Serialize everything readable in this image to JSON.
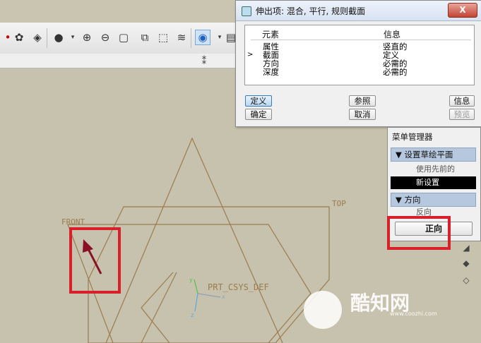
{
  "dialog": {
    "title": "伸出项: 混合, 平行, 规则截面",
    "close_label": "X",
    "columns": [
      "元素",
      "信息"
    ],
    "rows": [
      {
        "element": "属性",
        "info": "竖直的",
        "current": false
      },
      {
        "element": "截面",
        "info": "定义",
        "current": true
      },
      {
        "element": "方向",
        "info": "必需的",
        "current": false
      },
      {
        "element": "深度",
        "info": "必需的",
        "current": false
      }
    ],
    "current_marker": ">",
    "buttons": {
      "define": "定义",
      "reference": "参照",
      "info": "信息",
      "ok": "确定",
      "cancel": "取消",
      "preview": "预览"
    }
  },
  "menu": {
    "title": "菜单管理器",
    "section1": "设置草绘平面",
    "item_use_previous": "使用先前的",
    "item_new_setup": "新设置",
    "section2": "方向",
    "item_reverse": "反向",
    "button_okay": "正向"
  },
  "viewport": {
    "label_front": "FRONT",
    "label_top": "TOP",
    "label_csys": "PRT_CSYS_DEF",
    "axis_x": "x",
    "axis_y": "y",
    "axis_z": "z"
  },
  "watermark": {
    "text": "酷知网",
    "url": "www.coozhi.com"
  },
  "colors": {
    "datum": "#9c7b4e",
    "highlight": "#d9202a",
    "arrow": "#8a1026",
    "selected": "#000000",
    "section_header": "#b6c8de"
  }
}
